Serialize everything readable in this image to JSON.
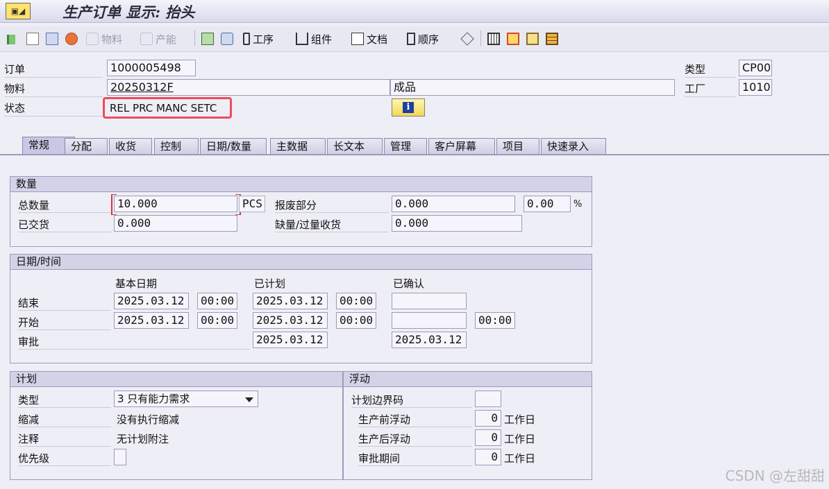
{
  "window": {
    "title": "生产订单 显示: 抬头"
  },
  "toolbar": {
    "items": [
      {
        "label": "物料",
        "icon": "material-icon"
      },
      {
        "label": "产能",
        "icon": "capacity-icon"
      },
      {
        "label": "工序",
        "icon": "operation-icon"
      },
      {
        "label": "组件",
        "icon": "component-icon"
      },
      {
        "label": "文档",
        "icon": "document-icon"
      },
      {
        "label": "顺序",
        "icon": "sequence-icon"
      }
    ]
  },
  "header": {
    "order_label": "订单",
    "order_value": "1000005498",
    "material_label": "物料",
    "material_value": "20250312F",
    "material_desc": "成品",
    "status_label": "状态",
    "status_value": "REL  PRC  MANC SETC",
    "type_label": "类型",
    "type_value": "CP00",
    "plant_label": "工厂",
    "plant_value": "1010"
  },
  "tabs": [
    "常规",
    "分配",
    "收货",
    "控制",
    "日期/数量",
    "主数据",
    "长文本",
    "管理",
    "客户屏幕",
    "项目",
    "快速录入"
  ],
  "quantity": {
    "title": "数量",
    "total_label": "总数量",
    "total_value": "10.000",
    "unit": "PCS",
    "scrap_label": "报废部分",
    "scrap_value": "0.000",
    "scrap_pct": "0.00",
    "pct_sign": "%",
    "delivered_label": "已交货",
    "delivered_value": "0.000",
    "under_over_label": "缺量/过量收货",
    "under_over_value": "0.000"
  },
  "dates": {
    "title": "日期/时间",
    "basic_header": "基本日期",
    "scheduled_header": "已计划",
    "confirmed_header": "已确认",
    "end_label": "结束",
    "start_label": "开始",
    "release_label": "审批",
    "end_basic_date": "2025.03.12",
    "end_basic_time": "00:00",
    "end_sched_date": "2025.03.12",
    "end_sched_time": "00:00",
    "start_basic_date": "2025.03.12",
    "start_basic_time": "00:00",
    "start_sched_date": "2025.03.12",
    "start_sched_time": "00:00",
    "start_conf_time": "00:00",
    "release_sched_date": "2025.03.12",
    "release_conf_date": "2025.03.12"
  },
  "planning": {
    "title": "计划",
    "type_label": "类型",
    "type_value": "3 只有能力需求",
    "reduction_label": "缩减",
    "reduction_value": "没有执行缩减",
    "note_label": "注释",
    "note_value": "无计划附注",
    "priority_label": "优先级"
  },
  "float": {
    "title": "浮动",
    "sched_margin_label": "计划边界码",
    "float_before_label": "生产前浮动",
    "float_before_value": "0",
    "float_after_label": "生产后浮动",
    "float_after_value": "0",
    "release_period_label": "审批期间",
    "release_period_value": "0",
    "unit": "工作日"
  },
  "watermark": "CSDN @左甜甜"
}
